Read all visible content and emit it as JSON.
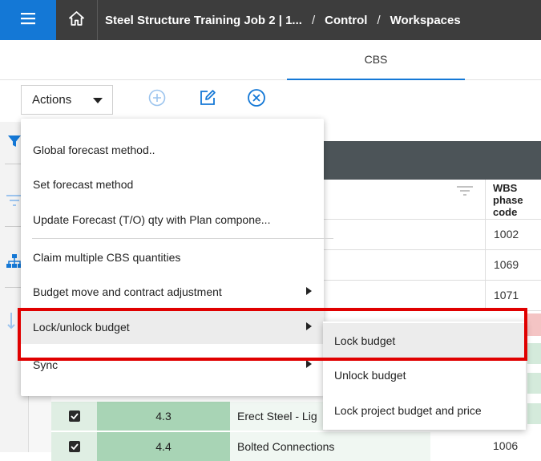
{
  "header": {
    "breadcrumb": [
      "Steel Structure Training Job 2 | 1...",
      "Control",
      "Workspaces"
    ],
    "separator": "/",
    "menu_icon": "hamburger-icon",
    "home_icon": "home-icon"
  },
  "tabs": [
    {
      "label": "CBS",
      "active": true
    }
  ],
  "toolbar": {
    "actions_label": "Actions",
    "icons": [
      "add-circle-icon",
      "edit-icon",
      "cancel-circle-icon"
    ]
  },
  "left_rail": {
    "icons": [
      "filter-icon",
      "filter-lines-icon",
      "hierarchy-icon",
      "sort-icon"
    ]
  },
  "grid": {
    "wbs_header": [
      "WBS",
      "phase",
      "code"
    ],
    "rows": [
      {
        "wbs": "1002"
      },
      {
        "wbs": "1069"
      },
      {
        "wbs": "1071"
      }
    ],
    "visible_rows": [
      {
        "code": "4.3",
        "name": "Erect Steel - Lig",
        "wbs": ""
      },
      {
        "code": "4.4",
        "name": "Bolted Connections",
        "wbs": "1006"
      }
    ]
  },
  "actions_menu": {
    "items": [
      {
        "label": "Global forecast method..",
        "has_submenu": false
      },
      {
        "label": "Set forecast method",
        "has_submenu": false
      },
      {
        "label": "Update Forecast (T/O) qty with Plan compone...",
        "has_submenu": false
      },
      {
        "label": "Claim multiple CBS quantities",
        "has_submenu": false
      },
      {
        "label": "Budget move and contract adjustment",
        "has_submenu": true
      },
      {
        "label": "Lock/unlock budget",
        "has_submenu": true,
        "active": true
      },
      {
        "label": "Sync",
        "has_submenu": true
      }
    ]
  },
  "submenu": {
    "items": [
      {
        "label": "Lock budget",
        "hover": true
      },
      {
        "label": "Unlock budget"
      },
      {
        "label": "Lock project budget and price"
      }
    ]
  },
  "colors": {
    "topbar": "#3d3d3d",
    "accent": "#1478d6",
    "highlight": "#e00000",
    "grid_band": "#4c5458",
    "code_cell": "#a8d4b5"
  }
}
